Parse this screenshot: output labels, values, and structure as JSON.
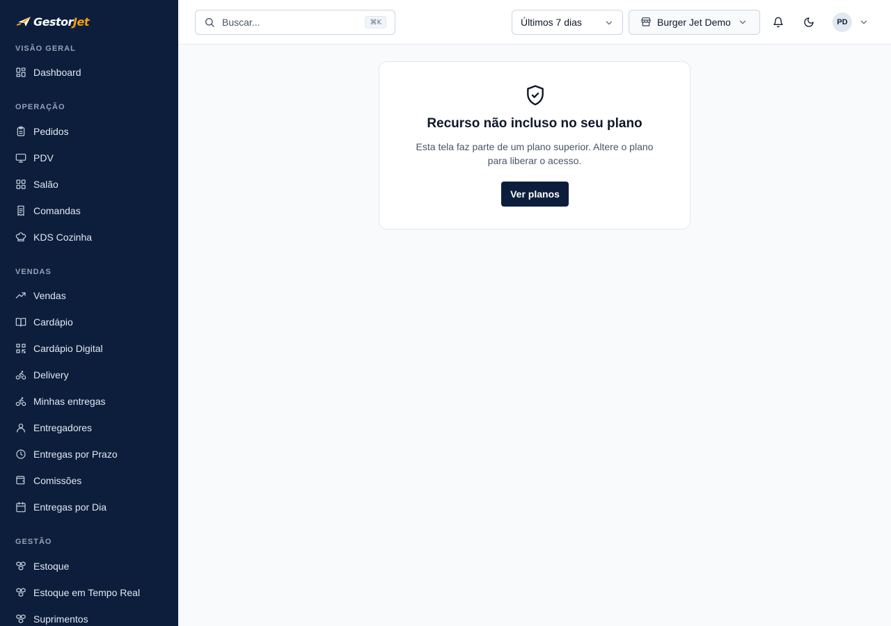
{
  "brand": {
    "prefix": "Gestor",
    "accent": "Jet",
    "accent_color": "#f59e0b",
    "sidebar_bg": "#0c1e3c"
  },
  "sidebar": {
    "sections": [
      {
        "label": "Visão geral",
        "items": [
          {
            "label": "Dashboard",
            "icon": "dashboard-icon"
          }
        ]
      },
      {
        "label": "Operação",
        "items": [
          {
            "label": "Pedidos",
            "icon": "clipboard-icon"
          },
          {
            "label": "PDV",
            "icon": "monitor-icon"
          },
          {
            "label": "Salão",
            "icon": "grid-icon"
          },
          {
            "label": "Comandas",
            "icon": "receipt-icon"
          },
          {
            "label": "KDS Cozinha",
            "icon": "chef-hat-icon"
          }
        ]
      },
      {
        "label": "Vendas",
        "items": [
          {
            "label": "Vendas",
            "icon": "trending-up-icon"
          },
          {
            "label": "Cardápio",
            "icon": "book-icon"
          },
          {
            "label": "Cardápio Digital",
            "icon": "qr-code-icon"
          },
          {
            "label": "Delivery",
            "icon": "bike-icon"
          },
          {
            "label": "Minhas entregas",
            "icon": "bike-icon"
          },
          {
            "label": "Entregadores",
            "icon": "user-icon"
          },
          {
            "label": "Entregas por Prazo",
            "icon": "clock-icon"
          },
          {
            "label": "Comissões",
            "icon": "wallet-icon"
          },
          {
            "label": "Entregas por Dia",
            "icon": "calendar-icon"
          }
        ]
      },
      {
        "label": "Gestão",
        "items": [
          {
            "label": "Estoque",
            "icon": "boxes-icon"
          },
          {
            "label": "Estoque em Tempo Real",
            "icon": "boxes-icon"
          },
          {
            "label": "Suprimentos",
            "icon": "boxes-icon"
          }
        ]
      }
    ]
  },
  "header": {
    "search_placeholder": "Buscar...",
    "search_shortcut": "⌘K",
    "period": "Últimos 7 dias",
    "store": "Burger Jet Demo",
    "user_initials": "PD"
  },
  "locked": {
    "title": "Recurso não incluso no seu plano",
    "description": "Esta tela faz parte de um plano superior. Altere o plano para liberar o acesso.",
    "button": "Ver planos"
  }
}
